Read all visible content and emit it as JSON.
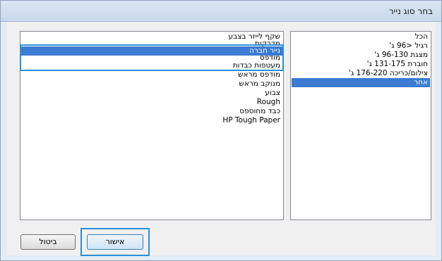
{
  "window": {
    "title": "בחר סוג נייר"
  },
  "left_list": {
    "items": [
      {
        "label": "שקף לייזר בצבע",
        "selected": false
      },
      {
        "label": "מדבקות",
        "selected": false
      },
      {
        "label": "נייר חברה",
        "selected": true
      },
      {
        "label": "מודפס",
        "selected": false
      },
      {
        "label": "מעטפות כבדות",
        "selected": false
      },
      {
        "label": "מודפס מראש",
        "selected": false
      },
      {
        "label": "מנוקב מראש",
        "selected": false
      },
      {
        "label": "צבוע",
        "selected": false
      },
      {
        "label": "Rough",
        "selected": false
      },
      {
        "label": "כבד מחוספס",
        "selected": false
      },
      {
        "label": "HP Tough Paper",
        "selected": false
      }
    ]
  },
  "right_list": {
    "items": [
      {
        "label": "הכל",
        "selected": false
      },
      {
        "label": "רגיל <96 ג'",
        "selected": false
      },
      {
        "label": "מצגת 96-130 ג'",
        "selected": false
      },
      {
        "label": "חוברת 131-175 ג'",
        "selected": false
      },
      {
        "label": "צילום/כריכה 176-220 ג'",
        "selected": false
      },
      {
        "label": "אחר",
        "selected": true
      }
    ]
  },
  "buttons": {
    "ok_label": "אישור",
    "cancel_label": "ביטול"
  },
  "colors": {
    "selection": "#3b7bd1",
    "focus": "#2d8fd8",
    "frame": "#e4ecf5"
  }
}
